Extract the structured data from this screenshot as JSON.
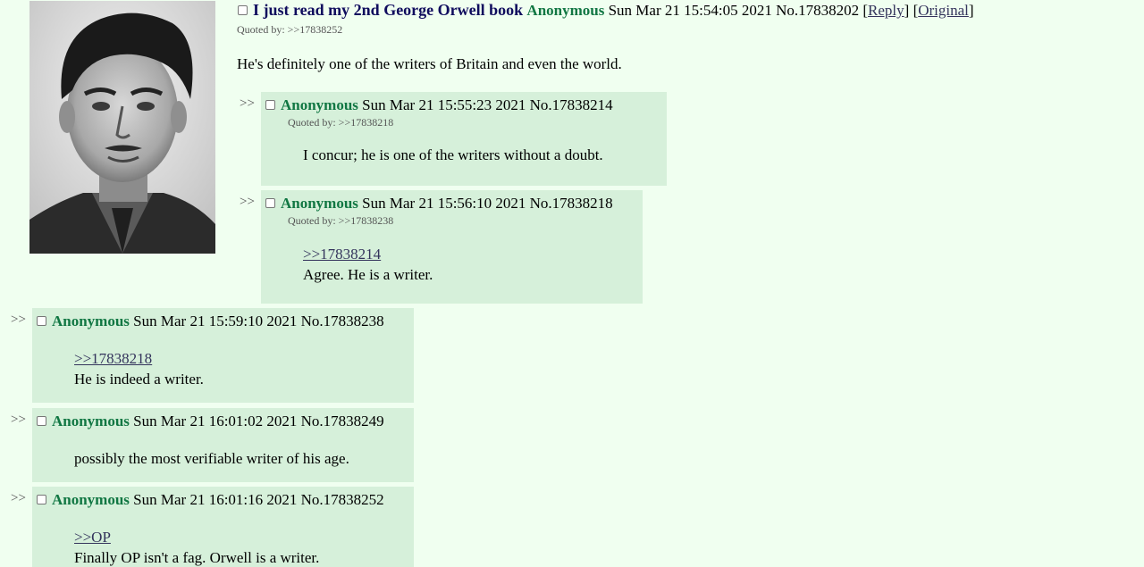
{
  "op": {
    "image_alt": "Portrait photograph",
    "subject": "I just read my 2nd George Orwell book",
    "name": "Anonymous",
    "datetime": "Sun Mar 21 15:54:05 2021",
    "post_no": "No.17838202",
    "reply_label": "Reply",
    "original_label": "Original",
    "quoted_by_label": "Quoted by:",
    "quoted_by_link": ">>17838252",
    "text": "He's definitely one of the writers of Britain and even the world."
  },
  "arrow_glyph": ">>",
  "replies": [
    {
      "name": "Anonymous",
      "datetime": "Sun Mar 21 15:55:23 2021",
      "post_no": "No.17838214",
      "quoted_by_label": "Quoted by:",
      "quoted_by_link": ">>17838218",
      "quote": "",
      "text": "I concur; he is one of the writers without a doubt."
    },
    {
      "name": "Anonymous",
      "datetime": "Sun Mar 21 15:56:10 2021",
      "post_no": "No.17838218",
      "quoted_by_label": "Quoted by:",
      "quoted_by_link": ">>17838238",
      "quote": ">>17838214",
      "text": "Agree. He is a writer."
    },
    {
      "name": "Anonymous",
      "datetime": "Sun Mar 21 15:59:10 2021",
      "post_no": "No.17838238",
      "quote": ">>17838218",
      "text": "He is indeed a writer."
    },
    {
      "name": "Anonymous",
      "datetime": "Sun Mar 21 16:01:02 2021",
      "post_no": "No.17838249",
      "quote": "",
      "text": "possibly the most verifiable writer of his age."
    },
    {
      "name": "Anonymous",
      "datetime": "Sun Mar 21 16:01:16 2021",
      "post_no": "No.17838252",
      "quote": ">>OP",
      "text": "Finally OP isn't a fag. Orwell is a writer."
    }
  ],
  "colors": {
    "background": "#f0fff0",
    "reply_bg": "#d6f0da",
    "subject": "#0f0c5d",
    "name": "#117743",
    "link": "#34345c"
  }
}
